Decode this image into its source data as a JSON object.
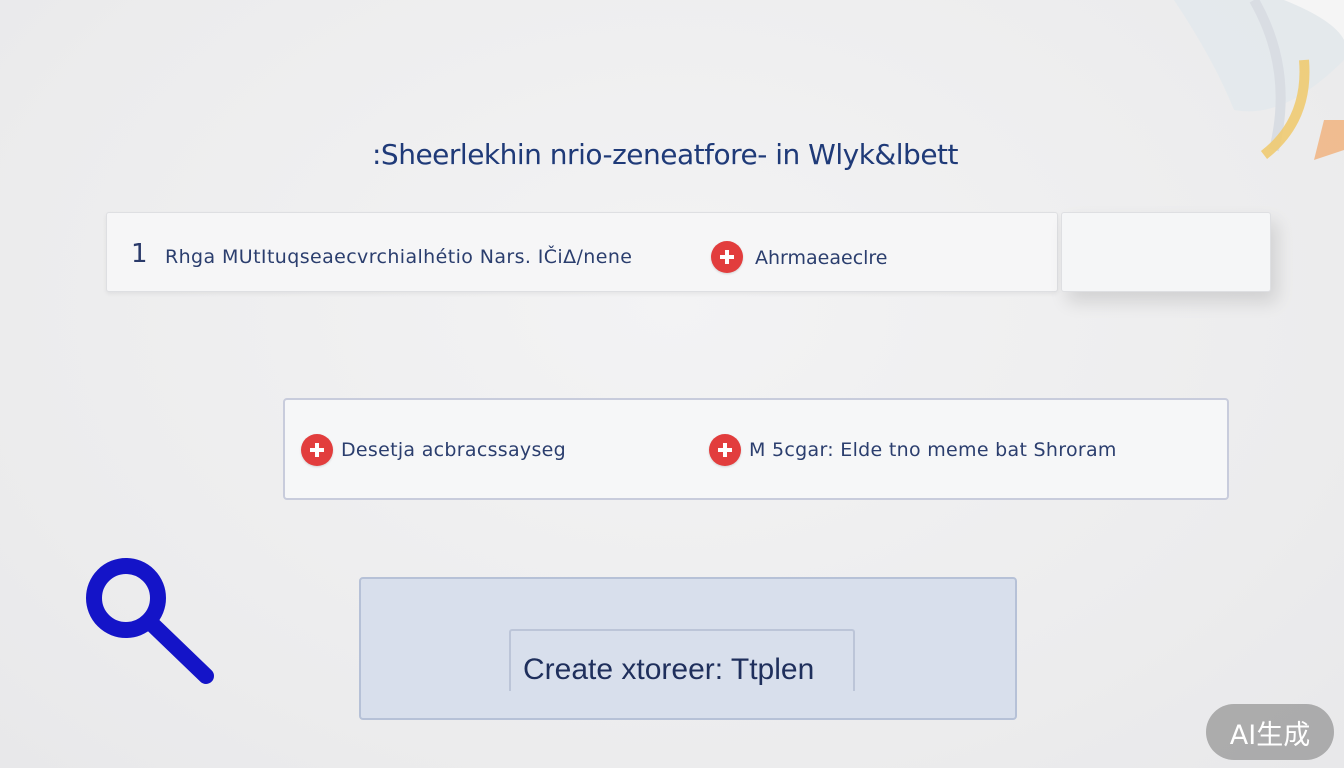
{
  "header": {
    "title": ":Sheerlekhin nrio-zeneatfore- in Wlyk&lbett"
  },
  "info_bar": {
    "index": "1",
    "text": "Rhga MUtItuqseaecvrchialhétio Nars. IČiΔ/nene",
    "secondary_text": "Ahrmaeaeclre"
  },
  "actions": [
    {
      "label": "Desetja acbracssayseg"
    },
    {
      "label": "M 5cgar: Elde tno meme bat Shroram"
    }
  ],
  "create_panel": {
    "button_label": "Create xtoreer: Ttplen"
  },
  "watermark": {
    "text": "AI生成"
  },
  "colors": {
    "title_text": "#1f3a78",
    "plus_icon": "#e23d3d",
    "search_icon": "#1414c8",
    "create_panel_bg": "#d8dfec"
  }
}
